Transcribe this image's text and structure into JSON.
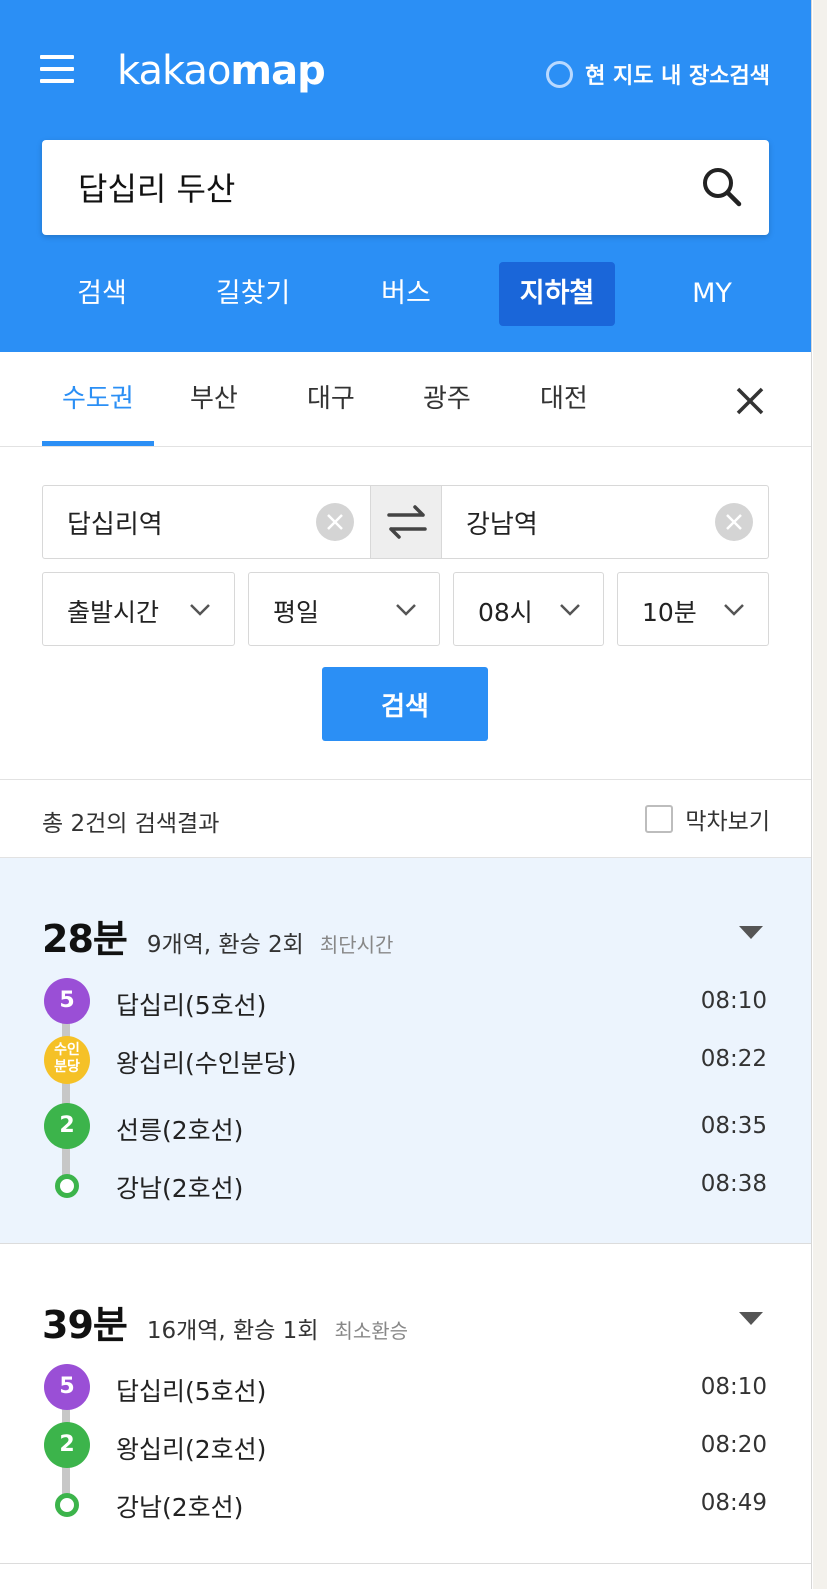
{
  "header": {
    "logo_light": "kakao",
    "logo_bold": "map",
    "map_search_label": "현 지도 내 장소검색",
    "search_value": "답십리 두산"
  },
  "main_tabs": [
    "검색",
    "길찾기",
    "버스",
    "지하철",
    "MY"
  ],
  "active_main_tab": "지하철",
  "region_tabs": [
    "수도권",
    "부산",
    "대구",
    "광주",
    "대전"
  ],
  "active_region_tab": "수도권",
  "route_form": {
    "origin": "답십리역",
    "destination": "강남역",
    "time_type": "출발시간",
    "day_type": "평일",
    "hour": "08시",
    "minute": "10분",
    "search_label": "검색"
  },
  "results": {
    "count_label": "총 2건의 검색결과",
    "last_train_label": "막차보기"
  },
  "routes": [
    {
      "duration": "28분",
      "info": "9개역, 환승 2회",
      "tag": "최단시간",
      "stops": [
        {
          "badge": "5",
          "name": "답십리(5호선)",
          "time": "08:10",
          "color": "#9a4fd6"
        },
        {
          "badge": "수인분당",
          "name": "왕십리(수인분당)",
          "time": "08:22",
          "color": "#f5c127"
        },
        {
          "badge": "2",
          "name": "선릉(2호선)",
          "time": "08:35",
          "color": "#3cb44b"
        },
        {
          "badge": "",
          "name": "강남(2호선)",
          "time": "08:38",
          "color": "#3cb44b"
        }
      ]
    },
    {
      "duration": "39분",
      "info": "16개역, 환승 1회",
      "tag": "최소환승",
      "stops": [
        {
          "badge": "5",
          "name": "답십리(5호선)",
          "time": "08:10",
          "color": "#9a4fd6"
        },
        {
          "badge": "2",
          "name": "왕십리(2호선)",
          "time": "08:20",
          "color": "#3cb44b"
        },
        {
          "badge": "",
          "name": "강남(2호선)",
          "time": "08:49",
          "color": "#3cb44b"
        }
      ]
    }
  ],
  "colors": {
    "brand_blue": "#2b8ff5",
    "active_tab_blue": "#1a66d9",
    "line5_purple": "#9a4fd6",
    "line2_green": "#3cb44b",
    "suin_bundang_yellow": "#f5c127",
    "selected_route_bg": "#ecf4fd"
  }
}
